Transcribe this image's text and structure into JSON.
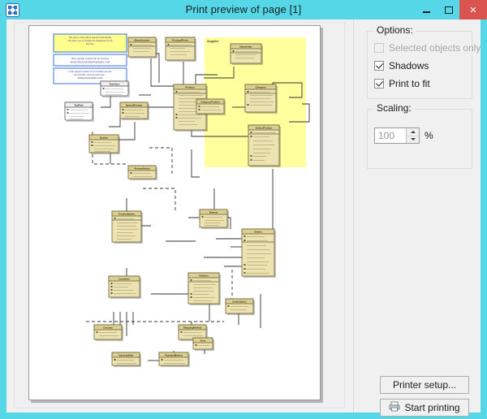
{
  "window": {
    "title": "Print preview of page [1]",
    "app_icon": "diagram-app-icon",
    "minimize_label": "–",
    "maximize_label": "□",
    "close_label": "×",
    "close_color": "#d9534f",
    "titlebar_color": "#56d7e8"
  },
  "options": {
    "group_title": "Options:",
    "items": [
      {
        "label": "Selected objects only",
        "checked": false,
        "enabled": false
      },
      {
        "label": "Shadows",
        "checked": true,
        "enabled": true
      },
      {
        "label": "Print to fit",
        "checked": true,
        "enabled": true
      }
    ]
  },
  "scaling": {
    "group_title": "Scaling:",
    "value": "100",
    "unit": "%",
    "spin_up": "▲",
    "spin_down": "▼"
  },
  "actions": {
    "printer_setup": "Printer setup...",
    "start_printing": "Start printing",
    "printer_icon": "printer-icon"
  },
  "preview": {
    "page_number": 1,
    "notes": [
      {
        "style": "yellow",
        "text": "This demo model will be opened automatically only when you run DeZign for Databases for the first time."
      },
      {
        "style": "white",
        "text": "More sample models can be found at WWW.DEZIGNFORDATABASES.COM"
      },
      {
        "style": "white",
        "text": "In the support section of our website you can find tutorials, how-tos and more... WWW.DATANAMIC.COM"
      }
    ],
    "highlight_label": "Supplier",
    "entities": [
      {
        "name": "Manufacturer",
        "attributes": [
          "ManufacturerID",
          "ManufacturerName",
          "Website"
        ]
      },
      {
        "name": "ProductPhoto",
        "attributes": [
          "ProductPhotoID",
          "Photo",
          "PhotoCaption",
          "ProductID"
        ]
      },
      {
        "name": "Newsletter",
        "attributes": [
          "NewsletterID",
          "NewsletterName",
          "NewsletterImage"
        ]
      },
      {
        "name": "Product",
        "attributes": [
          "ProductID",
          "ProductName",
          "ProductDescription",
          "ProductPrice",
          "ProductCost",
          "ProductQuantityInStock",
          "ManufacturerID",
          "CategoryID",
          "TaxClassID",
          "DateAdded"
        ]
      },
      {
        "name": "CategoryProduct",
        "attributes": [
          "ProductID",
          "CategoryID"
        ]
      },
      {
        "name": "Category",
        "attributes": [
          "CategoryID",
          "CategoryName",
          "CategoryImage",
          "CategoryDescription",
          "ParentCategoryID"
        ]
      },
      {
        "name": "OrdersProduct",
        "attributes": [
          "OrdersProductID",
          "OrderID",
          "ProductID",
          "ProductName",
          "ProductPrice",
          "ProductTax",
          "Quantity",
          "Total"
        ]
      },
      {
        "name": "TaxRate",
        "attributes": [
          "TaxRateID",
          "TaxClassID",
          "TaxRate",
          "ZoneID"
        ]
      },
      {
        "name": "TaxClass",
        "attributes": [
          "TaxClassID",
          "TaxClassName",
          "TaxClassDescription"
        ]
      },
      {
        "name": "SpecialProduct",
        "attributes": [
          "ProductID",
          "SpecialPrice",
          "SpecialStartDate",
          "SpecialEndDate"
        ]
      },
      {
        "name": "Review",
        "attributes": [
          "ReviewID",
          "ProductID",
          "CustomerID",
          "ReviewText",
          "Rating",
          "DateAdded"
        ]
      },
      {
        "name": "ProductOption",
        "attributes": [
          "ProductOptionID",
          "ProductID",
          "OptionName",
          "OptionValue"
        ]
      },
      {
        "name": "ProductNotify",
        "attributes": [
          "ProductID",
          "CustomerID",
          "DateAdded"
        ]
      },
      {
        "name": "Basket",
        "attributes": [
          "BasketID",
          "CustomerID",
          "ProductID",
          "Quantity",
          "DateAdded"
        ]
      },
      {
        "name": "Orders",
        "attributes": [
          "OrderID",
          "CustomerID",
          "Address",
          "ShipName",
          "ShipAddress",
          "ShipCity",
          "ShipCountry",
          "OrderDate",
          "ShippedDate",
          "OrderStatusID"
        ]
      },
      {
        "name": "Customer",
        "attributes": [
          "CustomerID",
          "FirstName",
          "LastName",
          "EmailAddress",
          "Password",
          "Phone",
          "DateJoined"
        ]
      },
      {
        "name": "Address",
        "attributes": [
          "AddressID",
          "CustomerID",
          "AddressLine1",
          "AddressLine2",
          "City",
          "PostalCode",
          "CountryID",
          "AddressType"
        ]
      },
      {
        "name": "Country",
        "attributes": [
          "CountryID",
          "CountryName"
        ]
      },
      {
        "name": "Zone",
        "attributes": [
          "ZoneID",
          "ZoneName",
          "CountryID"
        ]
      },
      {
        "name": "OrderStatus",
        "attributes": [
          "OrderStatusID",
          "OrderStatusName"
        ]
      },
      {
        "name": "CurrencyRate",
        "attributes": [
          "CurrencyID",
          "CurrencyName",
          "ExchangeRate"
        ]
      },
      {
        "name": "PaymentMethod",
        "attributes": [
          "PaymentMethodID",
          "PaymentMethodName",
          "Description"
        ]
      },
      {
        "name": "ShippingMethod",
        "attributes": [
          "ShippingMethodID",
          "ShippingMethodName",
          "ShippingCost"
        ]
      },
      {
        "name": "Newsletter2",
        "attributes": [
          "NewsletterID",
          "CustomerID"
        ]
      }
    ]
  }
}
